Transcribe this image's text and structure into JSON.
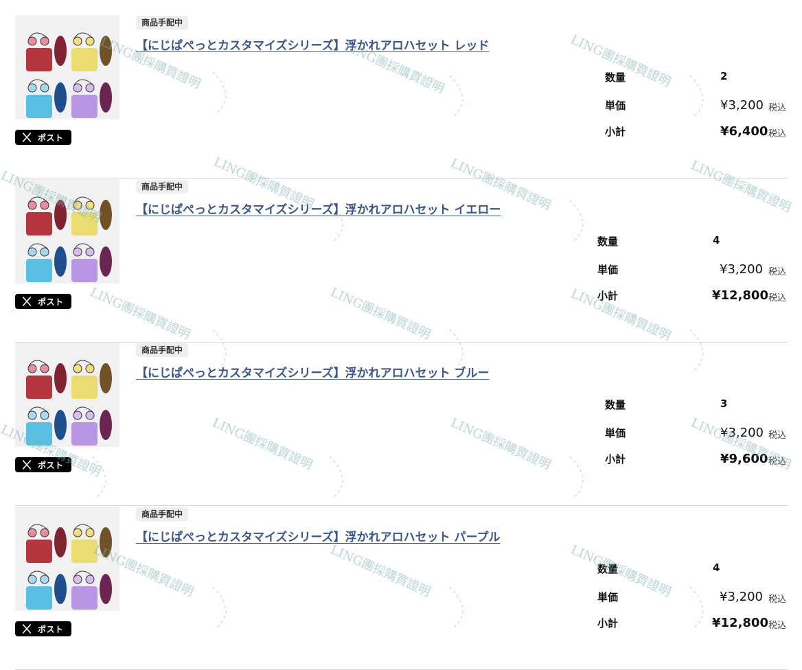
{
  "items": [
    {
      "status": "商品手配中",
      "title": "【にじぱぺっとカスタマイズシリーズ】浮かれアロハセット レッド",
      "post_label": "ポスト",
      "quantity_label": "数量",
      "quantity": "2",
      "unit_price_label": "単価",
      "unit_price": "¥3,200",
      "subtotal_label": "小計",
      "subtotal": "¥6,400",
      "tax_label": "税込"
    },
    {
      "status": "商品手配中",
      "title": "【にじぱぺっとカスタマイズシリーズ】浮かれアロハセット イエロー",
      "post_label": "ポスト",
      "quantity_label": "数量",
      "quantity": "4",
      "unit_price_label": "単価",
      "unit_price": "¥3,200",
      "subtotal_label": "小計",
      "subtotal": "¥12,800",
      "tax_label": "税込"
    },
    {
      "status": "商品手配中",
      "title": "【にじぱぺっとカスタマイズシリーズ】浮かれアロハセット ブルー",
      "post_label": "ポスト",
      "quantity_label": "数量",
      "quantity": "3",
      "unit_price_label": "単価",
      "unit_price": "¥3,200",
      "subtotal_label": "小計",
      "subtotal": "¥9,600",
      "tax_label": "税込"
    },
    {
      "status": "商品手配中",
      "title": "【にじぱぺっとカスタマイズシリーズ】浮かれアロハセット パープル",
      "post_label": "ポスト",
      "quantity_label": "数量",
      "quantity": "4",
      "unit_price_label": "単価",
      "unit_price": "¥3,200",
      "subtotal_label": "小計",
      "subtotal": "¥12,800",
      "tax_label": "税込"
    }
  ],
  "watermark": {
    "text": "LING團採購買證明",
    "text_color": "#7fb5b0",
    "stamp_color": "#e98a8a"
  },
  "colors": {
    "link": "#39558f",
    "badge_bg": "#eceef0",
    "post_button_bg": "#000000"
  }
}
